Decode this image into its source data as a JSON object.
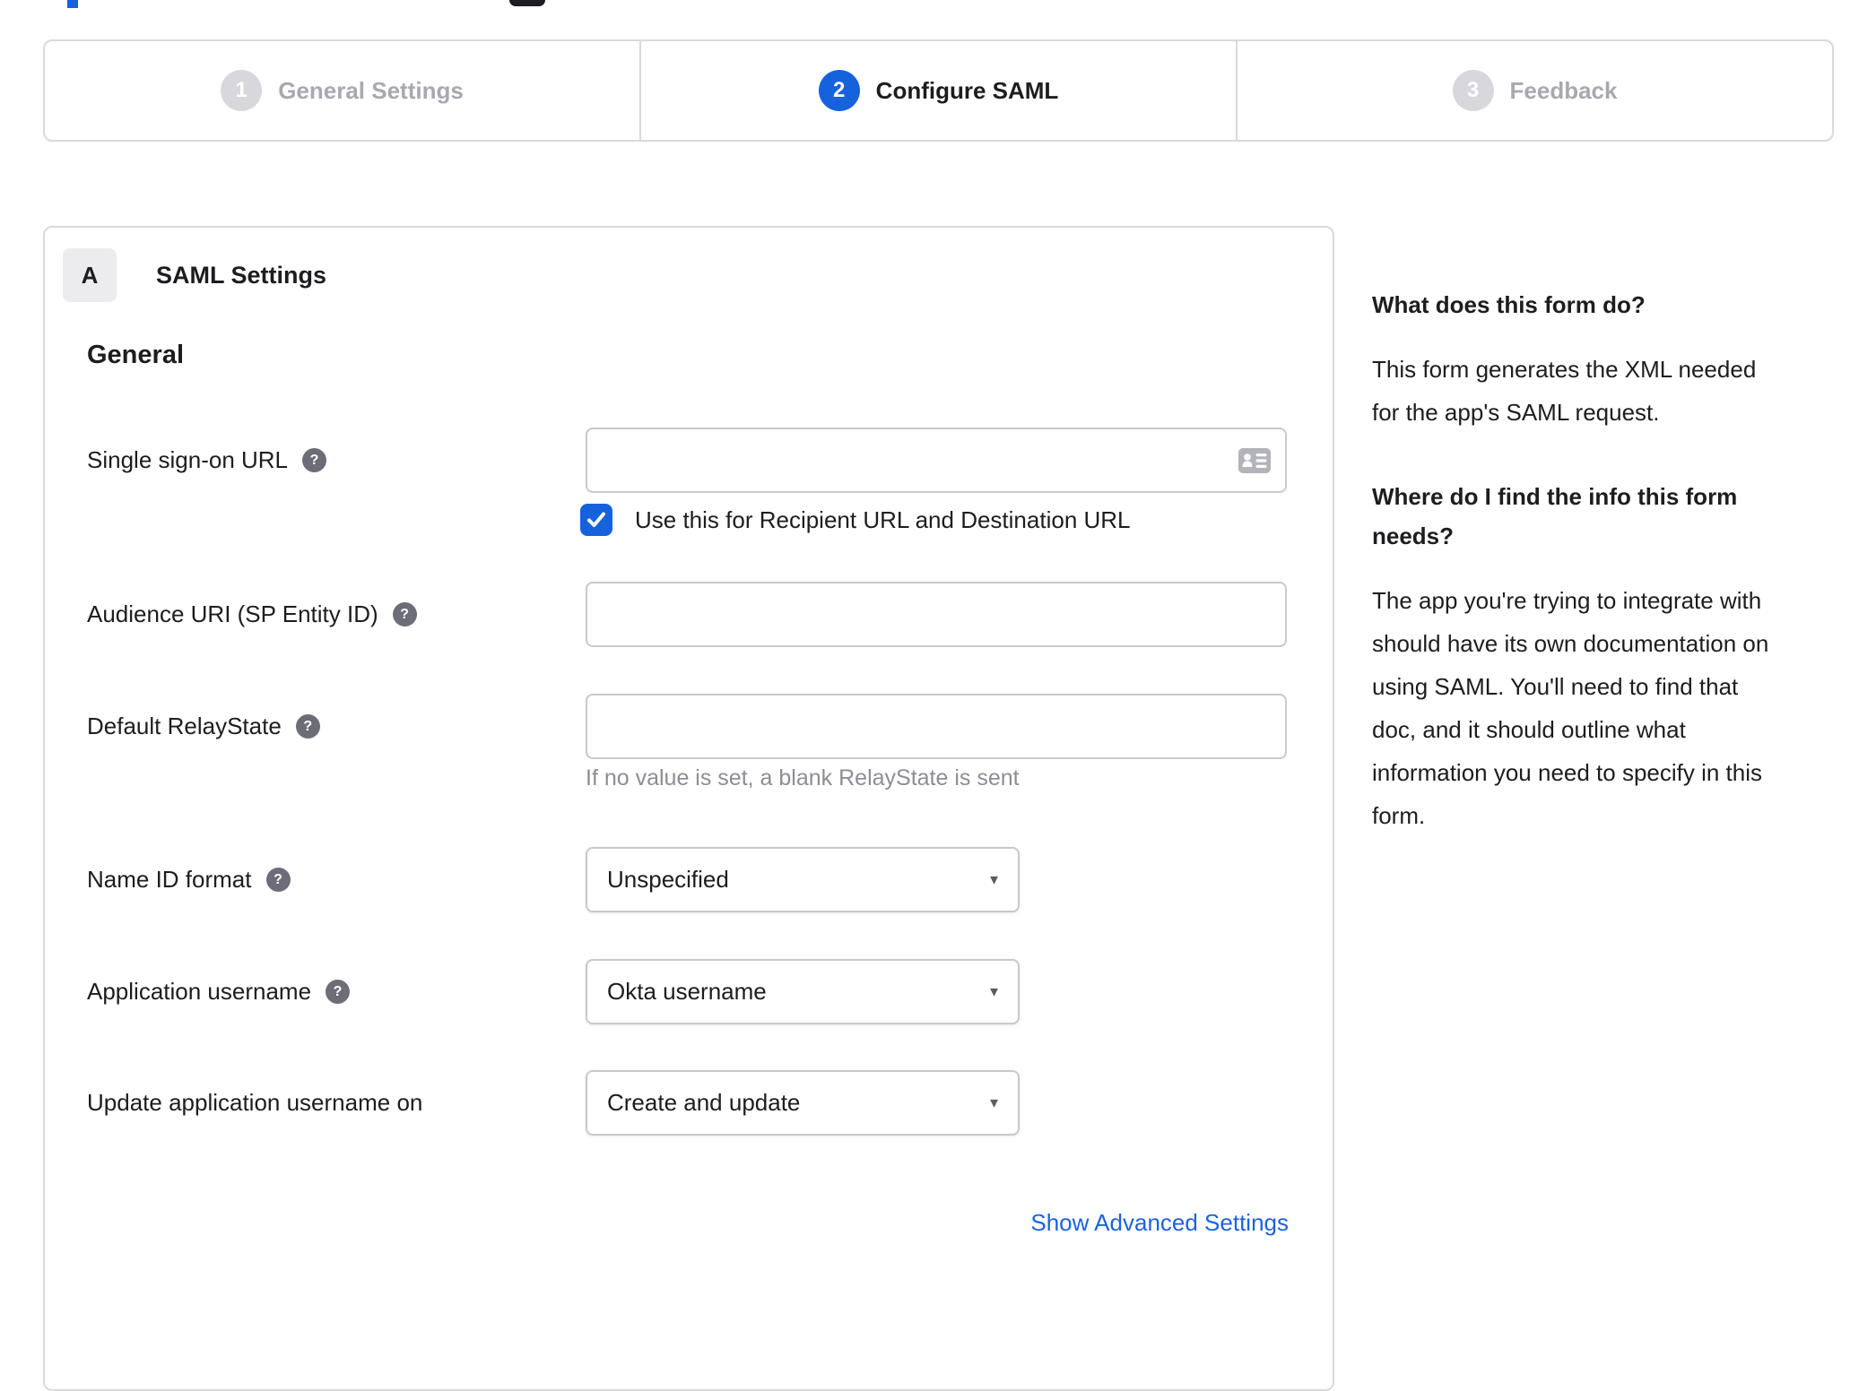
{
  "colors": {
    "accent_blue": "#1662dd",
    "border_gray": "#d9d9dd",
    "inactive_gray": "#a8a8b0",
    "text_dark": "#1d1d21",
    "hint_gray": "#8d8d95"
  },
  "icons": {
    "help_glyph": "?",
    "caret_glyph": "▾"
  },
  "stepper": {
    "steps": [
      {
        "number": "1",
        "label": "General Settings",
        "active": false
      },
      {
        "number": "2",
        "label": "Configure SAML",
        "active": true
      },
      {
        "number": "3",
        "label": "Feedback",
        "active": false
      }
    ]
  },
  "panel": {
    "section_badge": "A",
    "section_title": "SAML Settings",
    "group_heading": "General",
    "fields": [
      {
        "label": "Single sign-on URL",
        "type": "text",
        "value": "",
        "checkbox": {
          "checked": true,
          "label": "Use this for Recipient URL and Destination URL"
        }
      },
      {
        "label": "Audience URI (SP Entity ID)",
        "type": "text",
        "value": ""
      },
      {
        "label": "Default RelayState",
        "type": "text",
        "value": "",
        "hint": "If no value is set, a blank RelayState is sent"
      },
      {
        "label": "Name ID format",
        "type": "select",
        "value": "Unspecified"
      },
      {
        "label": "Application username",
        "type": "select",
        "value": "Okta username"
      },
      {
        "label": "Update application username on",
        "type": "select",
        "value": "Create and update"
      }
    ],
    "advanced_link": "Show Advanced Settings"
  },
  "sidebar": {
    "block1": {
      "heading": "What does this form do?",
      "lines": [
        "This form generates the XML needed",
        "for the app's SAML request."
      ]
    },
    "block2": {
      "heading_lines": [
        "Where do I find the info this form",
        "needs?"
      ],
      "lines": [
        "The app you're trying to integrate with",
        "should have its own documentation on",
        "using SAML. You'll need to find that",
        "doc, and it should outline what",
        "information you need to specify in this",
        "form."
      ]
    }
  }
}
